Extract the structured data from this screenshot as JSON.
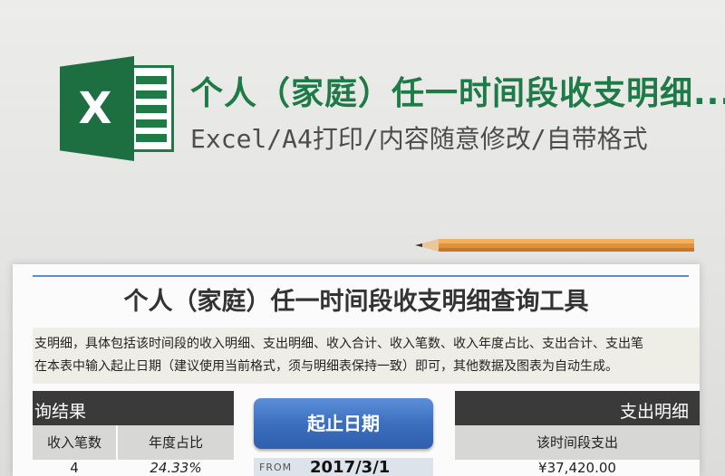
{
  "banner": {
    "title": "个人（家庭）任一时间段收支明细...",
    "subtitle": "Excel/A4打印/内容随意修改/自带格式",
    "logo_letter": "X"
  },
  "sheet": {
    "title": "个人（家庭）任一时间段收支明细查询工具",
    "description": [
      "支明细，具体包括该时间段的收入明细、支出明细、收入合计、收入笔数、收入年度占比、支出合计、支出笔",
      "在本表中输入起止日期（建议使用当前格式，须与明细表保持一致）即可，其他数据及图表为自动生成。"
    ],
    "left_header": "询结果",
    "left_columns": [
      "收入笔数",
      "年度占比"
    ],
    "left_values": [
      "4",
      "24.33%"
    ],
    "date_button": "起止日期",
    "from_label": "FROM",
    "from_value": "2017/3/1",
    "right_header": "支出明细",
    "right_column": "该时间段支出",
    "right_value": "¥37,420.00"
  },
  "colors": {
    "excel_green": "#1e7a46",
    "header_dark": "#3a3a3a",
    "button_blue": "#3b6fbf"
  }
}
